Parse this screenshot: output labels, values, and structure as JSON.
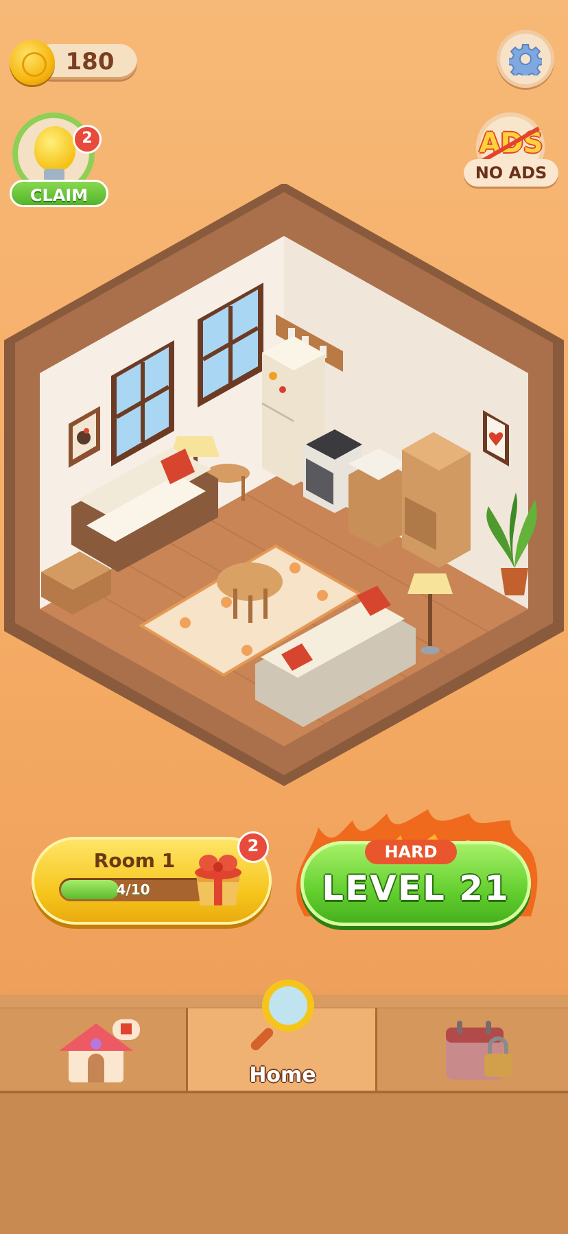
{
  "top_bar": {
    "coin_count": "180"
  },
  "claim_hint": {
    "badge_count": "2",
    "label": "CLAIM"
  },
  "no_ads": {
    "icon_text": "ADS",
    "label": "NO ADS"
  },
  "room_progress": {
    "room_name": "Room 1",
    "progress_text": "4/10",
    "progress_current": 4,
    "progress_total": 10,
    "badge_count": "2"
  },
  "level_button": {
    "difficulty": "HARD",
    "label": "LEVEL  21"
  },
  "bottom_nav": {
    "home_label": "Home",
    "active_tab": "home"
  },
  "colors": {
    "background": "#f5ad66",
    "accent_green": "#63cf2f",
    "accent_yellow": "#f6c51c",
    "badge_red": "#e84a3c",
    "difficulty_red": "#e9562d"
  }
}
